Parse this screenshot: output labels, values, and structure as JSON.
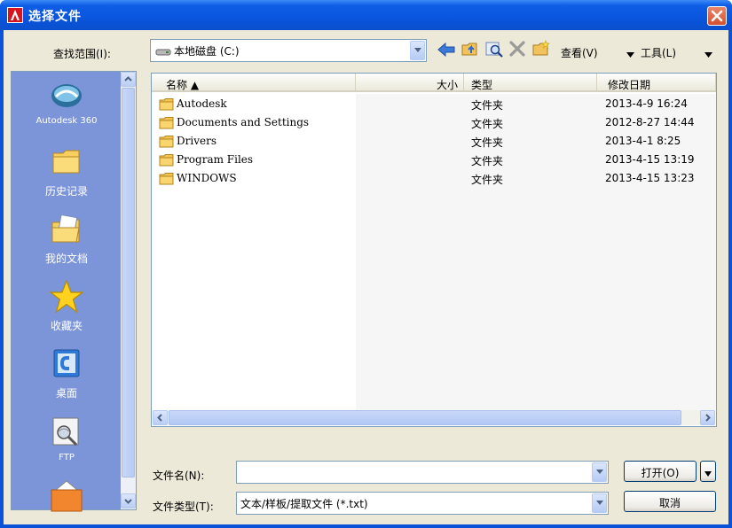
{
  "window": {
    "title": "选择文件"
  },
  "lookin": {
    "label": "查找范围(I):",
    "value": "本地磁盘 (C:)"
  },
  "toolbar": {
    "view_label": "查看(V)",
    "tools_label": "工具(L)"
  },
  "places": [
    {
      "name": "Autodesk 360",
      "icon": "cloud-icon"
    },
    {
      "name": "历史记录",
      "icon": "folder-icon"
    },
    {
      "name": "我的文档",
      "icon": "documents-icon"
    },
    {
      "name": "收藏夹",
      "icon": "star-icon"
    },
    {
      "name": "桌面",
      "icon": "desktop-icon"
    },
    {
      "name": "FTP",
      "icon": "ftp-icon"
    }
  ],
  "columns": {
    "name": "名称 ▲",
    "size": "大小",
    "type": "类型",
    "modified": "修改日期"
  },
  "files": [
    {
      "name": "Autodesk",
      "type": "文件夹",
      "modified": "2013-4-9 16:24"
    },
    {
      "name": "Documents and Settings",
      "type": "文件夹",
      "modified": "2012-8-27 14:44"
    },
    {
      "name": "Drivers",
      "type": "文件夹",
      "modified": "2013-4-1 8:25"
    },
    {
      "name": "Program Files",
      "type": "文件夹",
      "modified": "2013-4-15 13:19"
    },
    {
      "name": "WINDOWS",
      "type": "文件夹",
      "modified": "2013-4-15 13:23"
    }
  ],
  "filename": {
    "label": "文件名(N):",
    "value": ""
  },
  "filetype": {
    "label": "文件类型(T):",
    "value": "文本/样板/提取文件 (*.txt)"
  },
  "buttons": {
    "open": "打开(O)",
    "cancel": "取消"
  },
  "colors": {
    "title_blue": "#0a55dd",
    "places_bg": "#7c95d9",
    "client_bg": "#ece9d8"
  }
}
